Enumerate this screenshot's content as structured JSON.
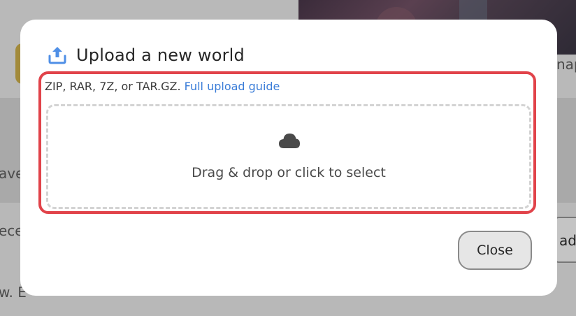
{
  "background": {
    "left_partial_1": "ave",
    "left_partial_2": "ece",
    "left_partial_3": "w. E",
    "right_partial_1": "nap",
    "right_partial_2": "ad"
  },
  "modal": {
    "title": "Upload a new world",
    "icon": "upload-icon",
    "formats_text": "ZIP, RAR, 7Z, or TAR.GZ.",
    "guide_link": "Full upload guide",
    "dropzone": {
      "icon": "cloud-icon",
      "text": "Drag & drop or click to select"
    },
    "close_label": "Close",
    "highlight_color": "#e1434a",
    "link_color": "#3b7dd8"
  }
}
